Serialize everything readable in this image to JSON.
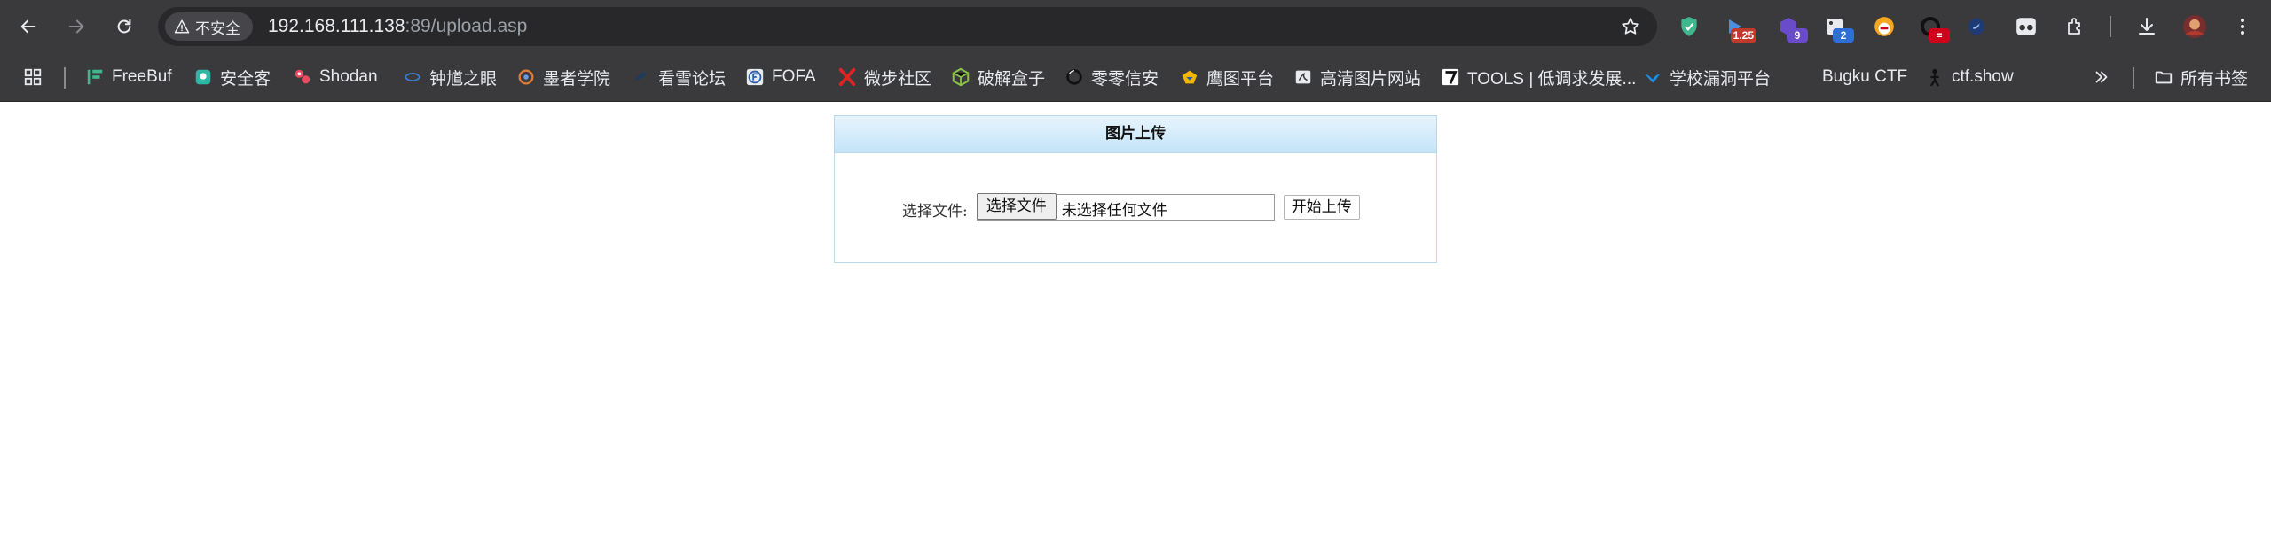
{
  "browser": {
    "insecure_label": "不安全",
    "url_host": "192.168.111.138",
    "url_rest": ":89/upload.asp",
    "extensions": [
      {
        "name": "shield-ext",
        "badge": ""
      },
      {
        "name": "video-ext",
        "badge": "1.25"
      },
      {
        "name": "hex-ext",
        "badge": "9"
      },
      {
        "name": "dice-ext",
        "badge": "2"
      },
      {
        "name": "cup-ext",
        "badge": ""
      },
      {
        "name": "g-ext",
        "badge": "="
      },
      {
        "name": "bird-ext",
        "badge": ""
      },
      {
        "name": "glasses-ext",
        "badge": ""
      }
    ]
  },
  "bookmarks": {
    "items": [
      {
        "label": "FreeBuf",
        "icon": "freebuf-icon"
      },
      {
        "label": "安全客",
        "icon": "anquanke-icon"
      },
      {
        "label": "Shodan",
        "icon": "shodan-icon"
      },
      {
        "label": "钟馗之眼",
        "icon": "zoomeye-icon"
      },
      {
        "label": "墨者学院",
        "icon": "mozhe-icon"
      },
      {
        "label": "看雪论坛",
        "icon": "kanxue-icon"
      },
      {
        "label": "FOFA",
        "icon": "fofa-icon"
      },
      {
        "label": "微步社区",
        "icon": "weibu-icon"
      },
      {
        "label": "破解盒子",
        "icon": "box-icon"
      },
      {
        "label": "零零信安",
        "icon": "zero-icon"
      },
      {
        "label": "鹰图平台",
        "icon": "hunter-icon"
      },
      {
        "label": "高清图片网站",
        "icon": "image-icon"
      },
      {
        "label": "TOOLS | 低调求发展...",
        "icon": "tools-icon"
      },
      {
        "label": "学校漏洞平台",
        "icon": "school-icon"
      },
      {
        "label": "Bugku CTF",
        "icon": "bugku-icon"
      },
      {
        "label": "ctf.show",
        "icon": "ctfshow-icon"
      }
    ],
    "all_bookmarks_label": "所有书签"
  },
  "upload_panel": {
    "title": "图片上传",
    "field_label": "选择文件:",
    "choose_button": "选择文件",
    "file_status": "未选择任何文件",
    "submit_button": "开始上传"
  },
  "colors": {
    "chrome_bg": "#3a3a3d",
    "panel_border": "#b9d8ea",
    "panel_header_top": "#e7f4fd",
    "panel_header_bottom": "#c4e4f8"
  }
}
